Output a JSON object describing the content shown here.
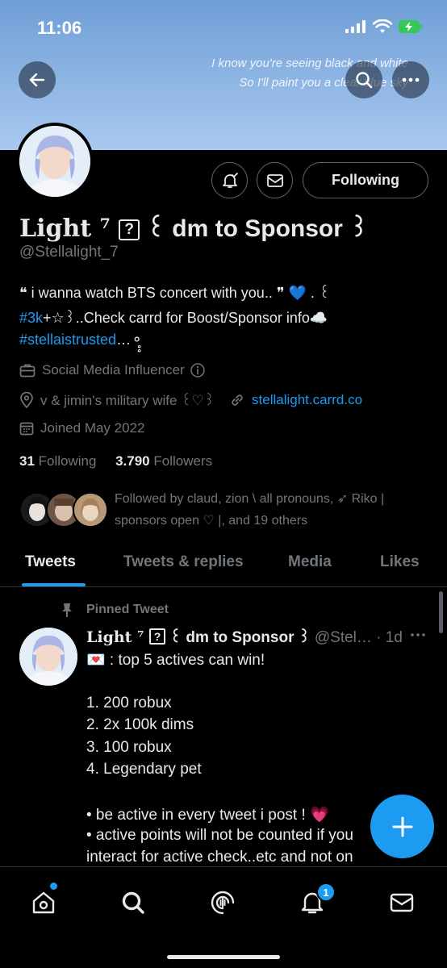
{
  "status_bar": {
    "time": "11:06"
  },
  "banner": {
    "lyric_line1": "I know you're seeing black and white",
    "lyric_line2": "So I'll paint you a clear blue sky"
  },
  "profile": {
    "name_prefix": "Light ⁷ ",
    "name_icon": "?",
    "name_suffix": " ꒰ dm to Sponsor ꒱",
    "handle": "@Stellalight_7",
    "following_button": "Following",
    "bio_line1": "❝ i wanna watch BTS concert with you.. ❞ 💙 . ꒰",
    "bio_hashtag1": "#3k",
    "bio_line2_rest": "+☆꒱..Check carrd for Boost/Sponsor info☁️",
    "bio_hashtag2": "#stellaistrusted",
    "bio_line3_rest": "…⚬̥̥",
    "category": "Social Media Influencer",
    "location": "v & jimin's military wife ꒰♡꒱",
    "website": "stellalight.carrd.co",
    "joined": "Joined May 2022",
    "following_count": "31",
    "following_label": "Following",
    "followers_count": "3.790",
    "followers_label": "Followers",
    "followed_by": "Followed by claud, zion \\ all pronouns, ➶ Riko | sponsors open ♡ |, and 19 others"
  },
  "tabs": [
    "Tweets",
    "Tweets & replies",
    "Media",
    "Likes"
  ],
  "pinned_tweet": {
    "pinned_label": "Pinned Tweet",
    "author_prefix": "Light ⁷ ",
    "author_icon": "?",
    "author_suffix": " ꒰ dm to Sponsor ꒱",
    "handle_time": " @Stel… · 1d",
    "lines": [
      "💌 : top 5 actives can win!",
      "1. 200 robux",
      "2. 2x 100k dims",
      "3. 100 robux",
      "4. Legendary pet",
      "• be active in every tweet i post ! 💗",
      "• active points will not be counted if you",
      "interact for active check..etc and not on"
    ]
  },
  "nav": {
    "notification_count": "1"
  },
  "colors": {
    "accent": "#1d9bf0",
    "background": "#000000",
    "muted": "#71767b"
  }
}
